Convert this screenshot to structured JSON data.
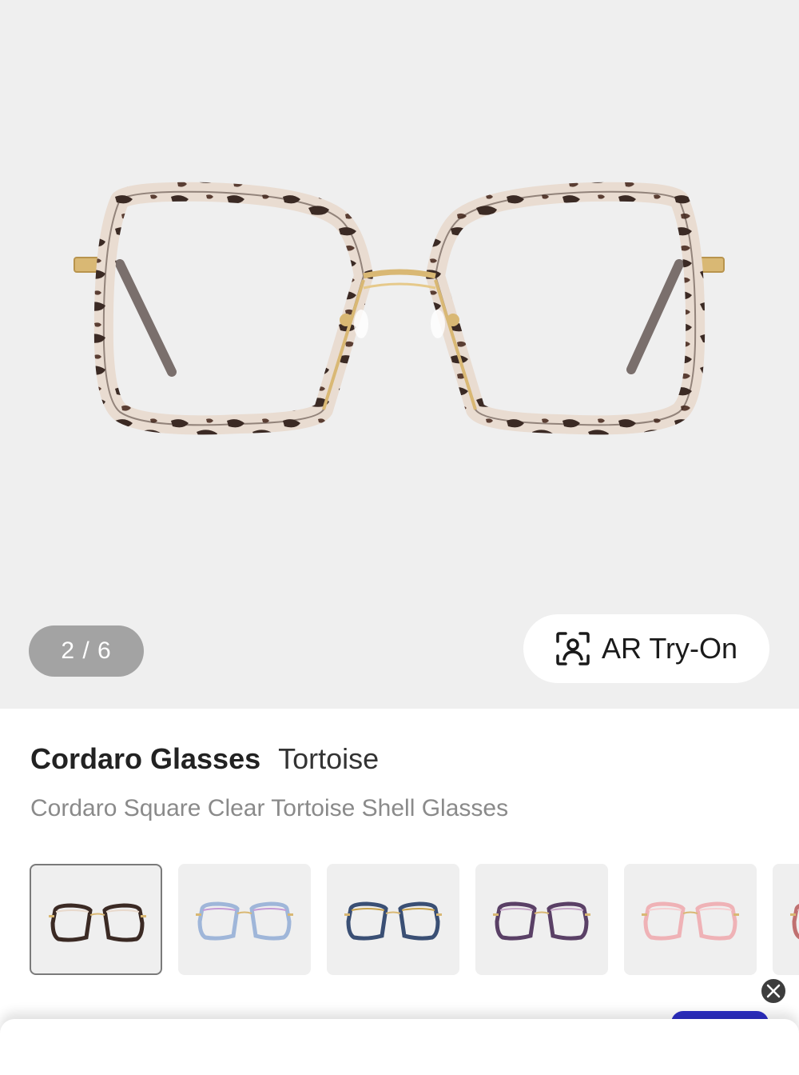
{
  "gallery": {
    "page_indicator": "2 / 6",
    "ar_label": "AR Try-On",
    "ar_icon": "face-scan-icon"
  },
  "product": {
    "name": "Cordaro Glasses",
    "variant": "Tortoise",
    "description": "Cordaro Square Clear Tortoise Shell Glasses"
  },
  "colors": {
    "hero_background": "#efefef",
    "tortoise_light": "#e8d9cc",
    "tortoise_dark": "#3b2a24",
    "gold": "#d9b874",
    "page_indicator_bg": "#a3a3a3",
    "chat_accent": "#2c2ec4"
  },
  "variants": [
    {
      "name": "tortoise",
      "rim": "#3b2a24",
      "accent": "#e8d9cc",
      "selected": true
    },
    {
      "name": "clear-blue",
      "rim": "#9fb6d9",
      "accent": "#c59ad6",
      "selected": false
    },
    {
      "name": "blue-tortoise",
      "rim": "#3a4f74",
      "accent": "#c9a24b",
      "selected": false
    },
    {
      "name": "purple-tortoise",
      "rim": "#5a4066",
      "accent": "#c7a9c9",
      "selected": false
    },
    {
      "name": "pink",
      "rim": "#efb2b6",
      "accent": "#f6d0d2",
      "selected": false
    },
    {
      "name": "partial",
      "rim": "#c07070",
      "accent": "#e0b0b0",
      "selected": false
    }
  ]
}
